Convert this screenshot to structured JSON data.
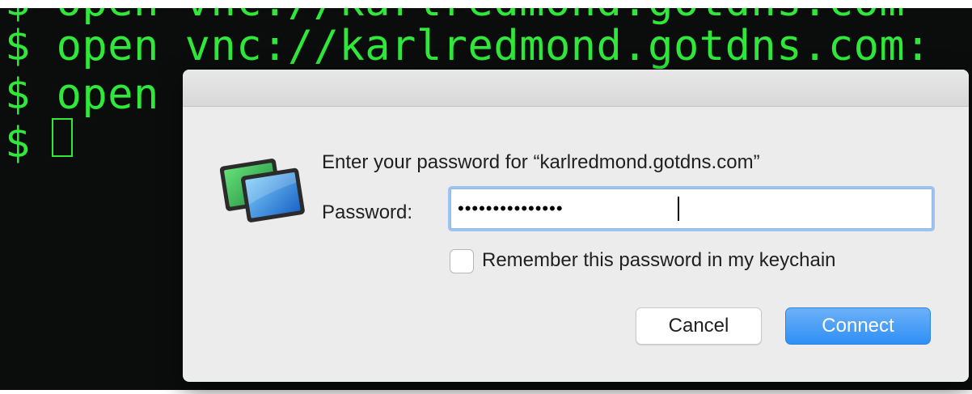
{
  "terminal": {
    "lines": [
      "$ open vnc://karlredmond.gotdns.com",
      "$ open vnc://karlredmond.gotdns.com:",
      "$ open v",
      "$ "
    ],
    "text_color": "#2fe83a",
    "background_color": "#0b0d0d"
  },
  "dialog": {
    "icon": "screen-sharing-app-icon",
    "prompt": "Enter your password for “karlredmond.gotdns.com”",
    "password_label": "Password:",
    "password_value": "•••••••••••••••",
    "remember_label": "Remember this password in my keychain",
    "remember_checked": false,
    "cancel_label": "Cancel",
    "connect_label": "Connect",
    "accent_color": "#2f8ff5",
    "focus_ring_color": "#9cc3f1"
  }
}
